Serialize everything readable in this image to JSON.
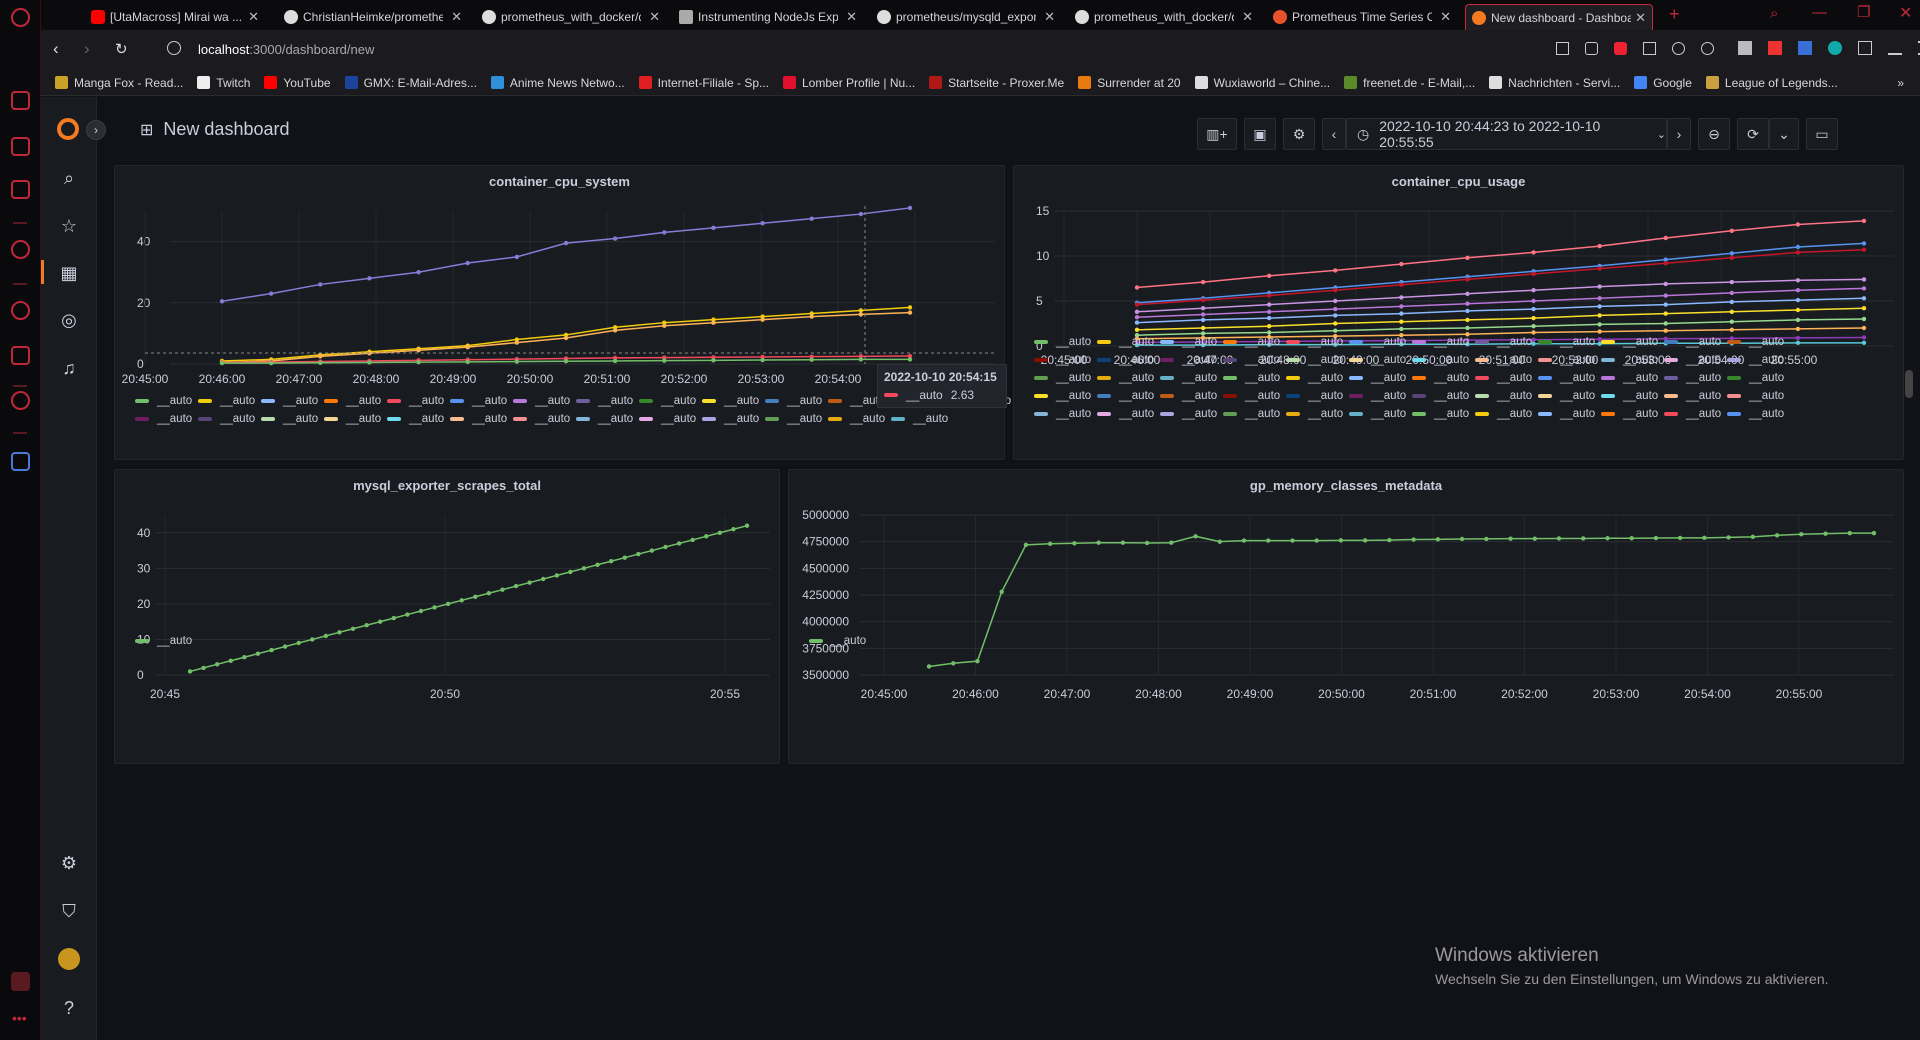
{
  "browser": {
    "tabs": [
      {
        "title": "[UtaMacross] Mirai wa ..."
      },
      {
        "title": "ChristianHeimke/promethe"
      },
      {
        "title": "prometheus_with_docker/d"
      },
      {
        "title": "Instrumenting NodeJs Expr"
      },
      {
        "title": "prometheus/mysqld_expor"
      },
      {
        "title": "prometheus_with_docker/d"
      },
      {
        "title": "Prometheus Time Series Co"
      },
      {
        "title": "New dashboard - Dashboa"
      }
    ],
    "url_host": "localhost",
    "url_path": ":3000/dashboard/new",
    "bookmarks": [
      "Manga Fox - Read...",
      "Twitch",
      "YouTube",
      "GMX: E-Mail-Adres...",
      "Anime News Netwo...",
      "Internet-Filiale - Sp...",
      "Lomber Profile | Nu...",
      "Startseite - Proxer.Me",
      "Surrender at 20",
      "Wuxiaworld – Chine...",
      "freenet.de - E-Mail,...",
      "Nachrichten - Servi...",
      "Google",
      "League of Legends..."
    ]
  },
  "dashboard": {
    "title": "New dashboard",
    "time_range": "2022-10-10 20:44:23 to 2022-10-10 20:55:55"
  },
  "tooltip": {
    "time": "2022-10-10 20:54:15",
    "label": "__auto",
    "value": "2.63"
  },
  "legend_label": "__auto",
  "os_notice": {
    "title": "Windows aktivieren",
    "text": "Wechseln Sie zu den Einstellungen, um Windows zu aktivieren."
  },
  "chart_data": [
    {
      "type": "line",
      "title": "container_cpu_system",
      "x": [
        "20:45:00",
        "20:46:00",
        "20:47:00",
        "20:48:00",
        "20:49:00",
        "20:50:00",
        "20:51:00",
        "20:52:00",
        "20:53:00",
        "20:54:00",
        "20:55:00"
      ],
      "ylim": [
        0,
        50
      ],
      "yticks": [
        0,
        20,
        40
      ],
      "series": [
        {
          "values_start": "20:46:00",
          "values": [
            20.5,
            23,
            26,
            28,
            30,
            33,
            35,
            39.5,
            41,
            43,
            44.5,
            46,
            47.5,
            49,
            51
          ],
          "color": "#8a7ad8"
        },
        {
          "values_start": "20:46:00",
          "values": [
            1,
            1.5,
            3,
            4,
            5,
            6,
            8,
            9.5,
            12,
            13.5,
            14.5,
            15.5,
            16.5,
            17.5,
            18.5
          ],
          "color": "#f2cc0c"
        },
        {
          "values_start": "20:46:00",
          "values": [
            0.5,
            1,
            2.5,
            3.5,
            4.5,
            5.5,
            7,
            8.5,
            11,
            12.5,
            13.5,
            14.5,
            15.5,
            16.2,
            16.8
          ],
          "color": "#ffb357"
        },
        {
          "values_start": "20:46:00",
          "values": [
            0.5,
            0.6,
            0.8,
            1,
            1.2,
            1.4,
            1.6,
            1.8,
            2,
            2.1,
            2.2,
            2.3,
            2.4,
            2.5,
            2.6
          ],
          "color": "#f2495c"
        },
        {
          "values_start": "20:46:00",
          "values": [
            0.3,
            0.3,
            0.4,
            0.5,
            0.6,
            0.7,
            0.8,
            0.9,
            1,
            1.1,
            1.2,
            1.3,
            1.4,
            1.5,
            1.5
          ],
          "color": "#73bf69"
        }
      ],
      "legend_count": 27
    },
    {
      "type": "line",
      "title": "container_cpu_usage",
      "x": [
        "20:45:00",
        "20:46:00",
        "20:47:00",
        "20:48:00",
        "20:49:00",
        "20:50:00",
        "20:51:00",
        "20:52:00",
        "20:53:00",
        "20:54:00",
        "20:55:00"
      ],
      "ylim": [
        0,
        15
      ],
      "yticks": [
        0,
        5,
        10,
        15
      ],
      "series": [
        {
          "values": [
            6.5,
            7.1,
            7.8,
            8.4,
            9.1,
            9.8,
            10.4,
            11.1,
            12,
            12.8,
            13.5,
            13.9
          ],
          "color": "#ff7383"
        },
        {
          "values": [
            4.8,
            5.3,
            5.9,
            6.5,
            7.1,
            7.7,
            8.3,
            8.9,
            9.6,
            10.3,
            11,
            11.4
          ],
          "color": "#5794f2"
        },
        {
          "values": [
            4.6,
            5.1,
            5.6,
            6.2,
            6.8,
            7.4,
            8,
            8.6,
            9.2,
            9.8,
            10.4,
            10.7
          ],
          "color": "#c4162a"
        },
        {
          "values": [
            3.8,
            4.2,
            4.6,
            5,
            5.4,
            5.8,
            6.2,
            6.6,
            6.9,
            7.1,
            7.3,
            7.4
          ],
          "color": "#ca95e5"
        },
        {
          "values": [
            3.2,
            3.5,
            3.8,
            4.1,
            4.4,
            4.7,
            5,
            5.3,
            5.6,
            5.9,
            6.2,
            6.4
          ],
          "color": "#b877d9"
        },
        {
          "values": [
            2.6,
            2.9,
            3.1,
            3.4,
            3.6,
            3.9,
            4.1,
            4.4,
            4.6,
            4.9,
            5.1,
            5.3
          ],
          "color": "#8ab8ff"
        },
        {
          "values": [
            1.8,
            2,
            2.2,
            2.5,
            2.7,
            2.9,
            3.1,
            3.4,
            3.6,
            3.8,
            4,
            4.2
          ],
          "color": "#fade2a"
        },
        {
          "values": [
            1.2,
            1.4,
            1.5,
            1.7,
            1.9,
            2,
            2.2,
            2.4,
            2.5,
            2.7,
            2.9,
            3
          ],
          "color": "#96d98d"
        },
        {
          "values": [
            0.8,
            0.9,
            1,
            1.1,
            1.2,
            1.3,
            1.5,
            1.6,
            1.7,
            1.8,
            1.9,
            2
          ],
          "color": "#ffb357"
        },
        {
          "values": [
            0.4,
            0.45,
            0.5,
            0.55,
            0.6,
            0.65,
            0.7,
            0.75,
            0.8,
            0.85,
            0.9,
            0.95
          ],
          "color": "#8f3bb8"
        },
        {
          "values": [
            0.1,
            0.1,
            0.15,
            0.15,
            0.2,
            0.2,
            0.25,
            0.25,
            0.3,
            0.3,
            0.35,
            0.35
          ],
          "color": "#5ac8d8"
        }
      ],
      "legend_count": 60
    },
    {
      "type": "line",
      "title": "mysql_exporter_scrapes_total",
      "x": [
        "20:45",
        "20:50",
        "20:55"
      ],
      "ylim": [
        0,
        45
      ],
      "yticks": [
        0,
        10,
        20,
        30,
        40
      ],
      "series": [
        {
          "values": [
            1,
            2,
            3,
            4,
            5,
            6,
            7,
            8,
            9,
            10,
            11,
            12,
            13,
            14,
            15,
            16,
            17,
            18,
            19,
            20,
            21,
            22,
            23,
            24,
            25,
            26,
            27,
            28,
            29,
            30,
            31,
            32,
            33,
            34,
            35,
            36,
            37,
            38,
            39,
            40,
            41,
            42
          ],
          "color": "#73bf69"
        }
      ],
      "legend_count": 1
    },
    {
      "type": "line",
      "title": "gp_memory_classes_metadata",
      "x": [
        "20:45:00",
        "20:46:00",
        "20:47:00",
        "20:48:00",
        "20:49:00",
        "20:50:00",
        "20:51:00",
        "20:52:00",
        "20:53:00",
        "20:54:00",
        "20:55:00"
      ],
      "ylim": [
        3500000,
        5000000
      ],
      "yticks": [
        3500000,
        3750000,
        4000000,
        4250000,
        4500000,
        4750000,
        5000000
      ],
      "series": [
        {
          "values": [
            3580000,
            3610000,
            3630000,
            4280000,
            4720000,
            4730000,
            4735000,
            4740000,
            4740000,
            4738000,
            4740000,
            4800000,
            4750000,
            4760000,
            4760000,
            4760000,
            4760000,
            4762000,
            4762000,
            4765000,
            4770000,
            4772000,
            4775000,
            4776000,
            4778000,
            4778000,
            4780000,
            4780000,
            4782000,
            4782000,
            4784000,
            4785000,
            4786000,
            4790000,
            4795000,
            4810000,
            4820000,
            4825000,
            4830000,
            4830000
          ],
          "color": "#73bf69"
        }
      ],
      "legend_count": 1
    }
  ]
}
